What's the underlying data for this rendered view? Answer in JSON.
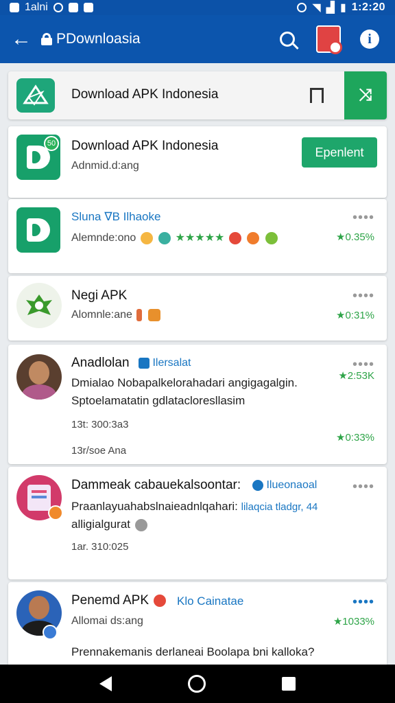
{
  "status_bar": {
    "left_text": "1alni",
    "time": "1:2:20"
  },
  "toolbar": {
    "title": "PDownloasia"
  },
  "header_card": {
    "title": "Download APK Indonesia"
  },
  "items": [
    {
      "title": "Download APK Indonesia",
      "subtitle": "Adnmid.d:ang",
      "badge": "50",
      "button_label": "Epenlent"
    },
    {
      "title": "Sluna ∇B Ilhaoke",
      "subtitle": "Alemnde:ono",
      "dots": "••••",
      "stars": "★★★★★",
      "rating": "★0.35%"
    },
    {
      "title": "Negi APK",
      "subtitle": "Alomnle:ane",
      "dots": "••••",
      "rating": "★0:31%"
    },
    {
      "title": "Anadlolan",
      "tag": "Ilersalat",
      "line1": "Dmialao Nobapalkelorahadari angigagalgin.",
      "line2": "Sptoelamatatin gdlatacloresllasim",
      "line3": "13t: 300:3a3",
      "line4": "13r/soe Ana",
      "dots": "••••",
      "rating1": "★2:53K",
      "rating2": "★0:33%"
    },
    {
      "title": "Dammeak cabauekalsoontar:",
      "tag": "Ilueonaoal",
      "line1": "Praanlayuahabslnaieadnlqahari:",
      "line1_link": "lilaqcia tladgr, 44",
      "line2": "alligialgurat",
      "line3": "1ar. 310:025",
      "dots": "••••"
    },
    {
      "title": "Penemd APK",
      "tag": "Klo Cainatae",
      "subtitle": "Allomai ds:ang",
      "line1": "Prennakemanis derlaneai Boolapa bni kalloka?",
      "dots": "••••",
      "rating": "★1033%"
    }
  ]
}
